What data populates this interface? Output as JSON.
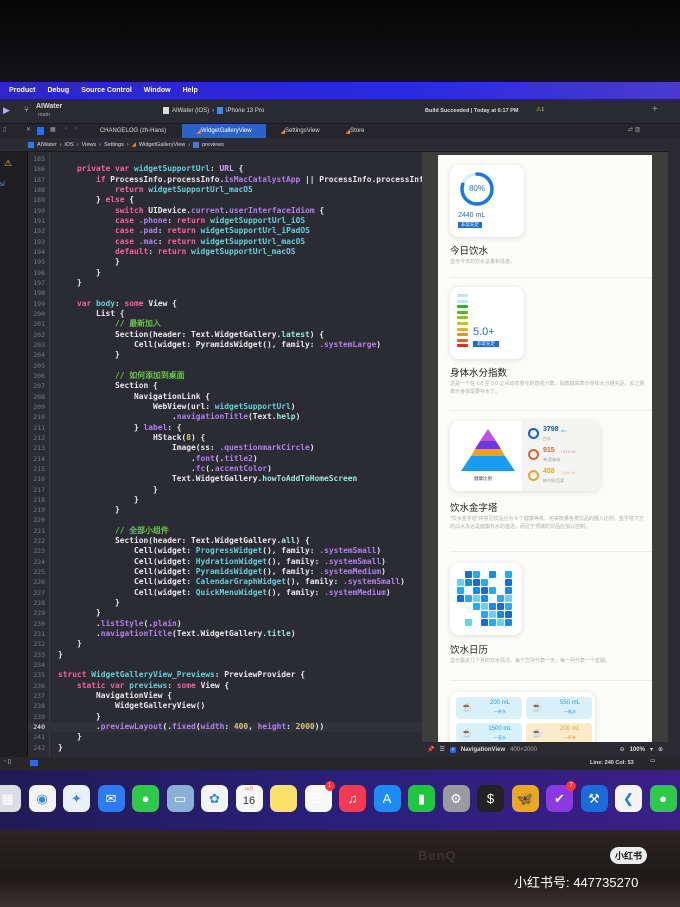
{
  "menu": [
    "Product",
    "Debug",
    "Source Control",
    "Window",
    "Help"
  ],
  "toolbar": {
    "project": "AIWater",
    "branch": "main",
    "scheme": "AIWater (iOS)",
    "device": "iPhone 13 Pro",
    "build_status": "Build Succeeded | Today at 6:17 PM",
    "warning_count": "1"
  },
  "tabs": [
    {
      "label": "CHANGELOG (zh-Hans)",
      "active": false
    },
    {
      "label": "WidgetGalleryView",
      "active": true
    },
    {
      "label": "SettingsView",
      "active": false
    },
    {
      "label": "Store",
      "active": false
    }
  ],
  "breadcrumbs": [
    "AIWater",
    "iOS",
    "Views",
    "Settings",
    "WidgetGalleryView",
    "previews"
  ],
  "code": {
    "first_line": 185,
    "current_line": 240,
    "lines": [
      [],
      [
        [
          "k",
          "    private var "
        ],
        [
          "i",
          "widgetSupportUrl"
        ],
        [
          "o",
          ": "
        ],
        [
          "t",
          "URL"
        ],
        [
          "o",
          " {"
        ]
      ],
      [
        [
          "k",
          "        if "
        ],
        [
          "o",
          "ProcessInfo.processInfo."
        ],
        [
          "p",
          "isMacCatalystApp"
        ],
        [
          "o",
          " || ProcessInfo.processInf"
        ]
      ],
      [
        [
          "k",
          "            return "
        ],
        [
          "i",
          "widgetSupportUrl_macOS"
        ]
      ],
      [
        [
          "o",
          "        } "
        ],
        [
          "k",
          "else"
        ],
        [
          "o",
          " {"
        ]
      ],
      [
        [
          "k",
          "            switch "
        ],
        [
          "o",
          "UIDevice."
        ],
        [
          "p",
          "current"
        ],
        [
          "o",
          "."
        ],
        [
          "p",
          "userInterfaceIdiom"
        ],
        [
          "o",
          " {"
        ]
      ],
      [
        [
          "k",
          "            case "
        ],
        [
          "p",
          ".phone"
        ],
        [
          "o",
          ": "
        ],
        [
          "k",
          "return "
        ],
        [
          "i",
          "widgetSupportUrl_iOS"
        ]
      ],
      [
        [
          "k",
          "            case "
        ],
        [
          "p",
          ".pad"
        ],
        [
          "o",
          ": "
        ],
        [
          "k",
          "return "
        ],
        [
          "i",
          "widgetSupportUrl_iPadOS"
        ]
      ],
      [
        [
          "k",
          "            case "
        ],
        [
          "p",
          ".mac"
        ],
        [
          "o",
          ": "
        ],
        [
          "k",
          "return "
        ],
        [
          "i",
          "widgetSupportUrl_macOS"
        ]
      ],
      [
        [
          "k",
          "            default"
        ],
        [
          "o",
          ": "
        ],
        [
          "k",
          "return "
        ],
        [
          "i",
          "widgetSupportUrl_macOS"
        ]
      ],
      [
        [
          "o",
          "            }"
        ]
      ],
      [
        [
          "o",
          "        }"
        ]
      ],
      [
        [
          "o",
          "    }"
        ]
      ],
      [],
      [
        [
          "k",
          "    var "
        ],
        [
          "i",
          "body"
        ],
        [
          "o",
          ": "
        ],
        [
          "k",
          "some "
        ],
        [
          "o",
          "View {"
        ]
      ],
      [
        [
          "o",
          "        List {"
        ]
      ],
      [
        [
          "c",
          "            // 最新加入"
        ]
      ],
      [
        [
          "o",
          "            Section(header: Text.WidgetGallery."
        ],
        [
          "m",
          "latest"
        ],
        [
          "o",
          ") {"
        ]
      ],
      [
        [
          "o",
          "                Cell(widget: PyramidsWidget(), family: "
        ],
        [
          "p",
          ".systemLarge"
        ],
        [
          "o",
          ")"
        ]
      ],
      [
        [
          "o",
          "            }"
        ]
      ],
      [],
      [
        [
          "c",
          "            // 如何添加到桌面"
        ]
      ],
      [
        [
          "o",
          "            Section {"
        ]
      ],
      [
        [
          "o",
          "                NavigationLink {"
        ]
      ],
      [
        [
          "o",
          "                    WebView(url: "
        ],
        [
          "i",
          "widgetSupportUrl"
        ],
        [
          "o",
          ")"
        ]
      ],
      [
        [
          "o",
          "                        ."
        ],
        [
          "p",
          "navigationTitle"
        ],
        [
          "o",
          "(Text."
        ],
        [
          "m",
          "help"
        ],
        [
          "o",
          ")"
        ]
      ],
      [
        [
          "o",
          "                } "
        ],
        [
          "p",
          "label"
        ],
        [
          "o",
          ": {"
        ]
      ],
      [
        [
          "o",
          "                    HStack("
        ],
        [
          "n",
          "8"
        ],
        [
          "o",
          ") {"
        ]
      ],
      [
        [
          "o",
          "                        Image(ss: "
        ],
        [
          "p",
          ".questionmarkCircle"
        ],
        [
          "o",
          ")"
        ]
      ],
      [
        [
          "o",
          "                            ."
        ],
        [
          "p",
          "font"
        ],
        [
          "o",
          "(."
        ],
        [
          "p",
          "title2"
        ],
        [
          "o",
          ")"
        ]
      ],
      [
        [
          "o",
          "                            ."
        ],
        [
          "p",
          "fc"
        ],
        [
          "o",
          "(."
        ],
        [
          "p",
          "accentColor"
        ],
        [
          "o",
          ")"
        ]
      ],
      [
        [
          "o",
          "                        Text.WidgetGallery."
        ],
        [
          "m",
          "howToAddToHomeScreen"
        ]
      ],
      [
        [
          "o",
          "                    }"
        ]
      ],
      [
        [
          "o",
          "                }"
        ]
      ],
      [
        [
          "o",
          "            }"
        ]
      ],
      [],
      [
        [
          "c",
          "            // 全部小组件"
        ]
      ],
      [
        [
          "o",
          "            Section(header: Text.WidgetGallery."
        ],
        [
          "m",
          "all"
        ],
        [
          "o",
          ") {"
        ]
      ],
      [
        [
          "o",
          "                Cell(widget: "
        ],
        [
          "i",
          "ProgressWidget"
        ],
        [
          "o",
          "(), family: "
        ],
        [
          "p",
          ".systemSmall"
        ],
        [
          "o",
          ")"
        ]
      ],
      [
        [
          "o",
          "                Cell(widget: "
        ],
        [
          "i",
          "HydrationWidget"
        ],
        [
          "o",
          "(), family: "
        ],
        [
          "p",
          ".systemSmall"
        ],
        [
          "o",
          ")"
        ]
      ],
      [
        [
          "o",
          "                Cell(widget: "
        ],
        [
          "i",
          "PyramidsWidget"
        ],
        [
          "o",
          "(), family: "
        ],
        [
          "p",
          ".systemMedium"
        ],
        [
          "o",
          ")"
        ]
      ],
      [
        [
          "o",
          "                Cell(widget: "
        ],
        [
          "i",
          "CalendarGraphWidget"
        ],
        [
          "o",
          "(), family: "
        ],
        [
          "p",
          ".systemSmall"
        ],
        [
          "o",
          ")"
        ]
      ],
      [
        [
          "o",
          "                Cell(widget: "
        ],
        [
          "i",
          "QuickMenuWidget"
        ],
        [
          "o",
          "(), family: "
        ],
        [
          "p",
          ".systemMedium"
        ],
        [
          "o",
          ")"
        ]
      ],
      [
        [
          "o",
          "            }"
        ]
      ],
      [
        [
          "o",
          "        }"
        ]
      ],
      [
        [
          "o",
          "        ."
        ],
        [
          "p",
          "listStyle"
        ],
        [
          "o",
          "(."
        ],
        [
          "p",
          "plain"
        ],
        [
          "o",
          ")"
        ]
      ],
      [
        [
          "o",
          "        ."
        ],
        [
          "p",
          "navigationTitle"
        ],
        [
          "o",
          "(Text.WidgetGallery."
        ],
        [
          "m",
          "title"
        ],
        [
          "o",
          ")"
        ]
      ],
      [
        [
          "o",
          "    }"
        ]
      ],
      [
        [
          "o",
          "}"
        ]
      ],
      [],
      [
        [
          "k",
          "struct "
        ],
        [
          "i",
          "WidgetGalleryView_Previews"
        ],
        [
          "o",
          ": PreviewProvider {"
        ]
      ],
      [
        [
          "k",
          "    static var "
        ],
        [
          "i",
          "previews"
        ],
        [
          "o",
          ": "
        ],
        [
          "k",
          "some "
        ],
        [
          "o",
          "View {"
        ]
      ],
      [
        [
          "o",
          "        NavigationView {"
        ]
      ],
      [
        [
          "o",
          "            WidgetGalleryView()"
        ]
      ],
      [
        [
          "o",
          "        }"
        ]
      ],
      [
        [
          "o",
          "        ."
        ],
        [
          "p",
          "previewLayout"
        ],
        [
          "o",
          "(."
        ],
        [
          "p",
          "fixed"
        ],
        [
          "o",
          "("
        ],
        [
          "p",
          "width"
        ],
        [
          "o",
          ": "
        ],
        [
          "n",
          "400"
        ],
        [
          "o",
          ", "
        ],
        [
          "p",
          "height"
        ],
        [
          "o",
          ": "
        ],
        [
          "n",
          "2000"
        ],
        [
          "o",
          "))"
        ]
      ],
      [
        [
          "o",
          "    }"
        ]
      ],
      [
        [
          "o",
          "}"
        ]
      ]
    ]
  },
  "preview": {
    "w1": {
      "percent": "80%",
      "progress": 0.8,
      "amount": "2440 mL",
      "badge": "非常充足",
      "title": "今日饮水",
      "desc": "显示今天的饮水总量和进度。"
    },
    "w2": {
      "score": "5.0+",
      "badge": "非常充足",
      "title": "身体水分指数",
      "desc": "这是一个在 1.0 至 5.0 之间动态变化的直观分数。指数越高表示身体水分越充足，反之则表示身体需要补水了。"
    },
    "w3": {
      "pyramid_label": "健康比例",
      "rows": [
        {
          "value": "3798",
          "unit": "mL",
          "label": "白水",
          "color": "#1560c8"
        },
        {
          "value": "915",
          "unit": "/ 915 mL",
          "label": "茶/黑咖啡",
          "color": "#d8642c"
        },
        {
          "value": "458",
          "unit": "/ 458 mL",
          "label": "纯牛奶/豆浆",
          "color": "#e8a630"
        }
      ],
      "title": "饮水金字塔",
      "desc": "“饮水金字塔”将常见饮品分为 6 个健康等级，用来衡量各类饮品的摄入比例。金字塔下方的白水永远是健康补水的首选，而位于顶端的饮品应加以控制。"
    },
    "w4": {
      "title": "饮水日历",
      "desc": "显示最近几个月的饮水情况。每个方块代表一天，每一列代表一个星期。"
    },
    "w5": {
      "items": [
        {
          "amount": "200 mL",
          "label": "一杯水",
          "bg": "#d8f0fa",
          "fg": "#2a9fd8"
        },
        {
          "amount": "550 mL",
          "label": "一瓶水",
          "bg": "#d8f0fa",
          "fg": "#2a9fd8"
        },
        {
          "amount": "1500 mL",
          "label": "一壶水",
          "bg": "#d8f0fa",
          "fg": "#2a9fd8"
        },
        {
          "amount": "200 mL",
          "label": "一杯茶",
          "bg": "#fcebc8",
          "fg": "#e0a040"
        }
      ]
    }
  },
  "preview_bar": {
    "view": "NavigationView",
    "size": "400×2000",
    "zoom": "100%"
  },
  "status": {
    "position": "Line: 240  Col: 53"
  },
  "dock": [
    {
      "name": "launchpad",
      "bg": "#dcdce4",
      "glyph": "▦"
    },
    {
      "name": "chrome",
      "bg": "#f4f4f4",
      "glyph": "◉"
    },
    {
      "name": "safari",
      "bg": "#e8f0fa",
      "glyph": "✦"
    },
    {
      "name": "mail",
      "bg": "#2a7cf0",
      "glyph": "✉"
    },
    {
      "name": "messages",
      "bg": "#2ec84a",
      "glyph": "●"
    },
    {
      "name": "preview",
      "bg": "#8ab0d8",
      "glyph": "▭"
    },
    {
      "name": "photos",
      "bg": "#f4f4f4",
      "glyph": "✿"
    },
    {
      "name": "calendar",
      "bg": "#f8f8f8",
      "glyph": "16",
      "month": "10月"
    },
    {
      "name": "notes",
      "bg": "#fbe06a",
      "glyph": ""
    },
    {
      "name": "reminders",
      "bg": "#f8f8f8",
      "glyph": "☰",
      "badge": "1"
    },
    {
      "name": "music",
      "bg": "#f43a52",
      "glyph": "♫"
    },
    {
      "name": "app-store",
      "bg": "#1a8cf4",
      "glyph": "A"
    },
    {
      "name": "numbers",
      "bg": "#1ec83c",
      "glyph": "▮"
    },
    {
      "name": "system-settings",
      "bg": "#9a9aa0",
      "glyph": "⚙"
    },
    {
      "name": "terminal",
      "bg": "#222",
      "glyph": "$"
    },
    {
      "name": "tes",
      "bg": "#e8a820",
      "glyph": "🦋"
    },
    {
      "name": "omnifocus",
      "bg": "#8a3ae0",
      "glyph": "✔",
      "badge": "7"
    },
    {
      "name": "xcode",
      "bg": "#1a6cd8",
      "glyph": "⚒"
    },
    {
      "name": "vscode",
      "bg": "#f4f4f4",
      "glyph": "❮"
    },
    {
      "name": "wechat",
      "bg": "#2ec84a",
      "glyph": "●"
    }
  ],
  "bezel": {
    "brand": "BenQ",
    "watermark_badge": "小红书",
    "watermark_id": "小红书号: 447735270"
  }
}
